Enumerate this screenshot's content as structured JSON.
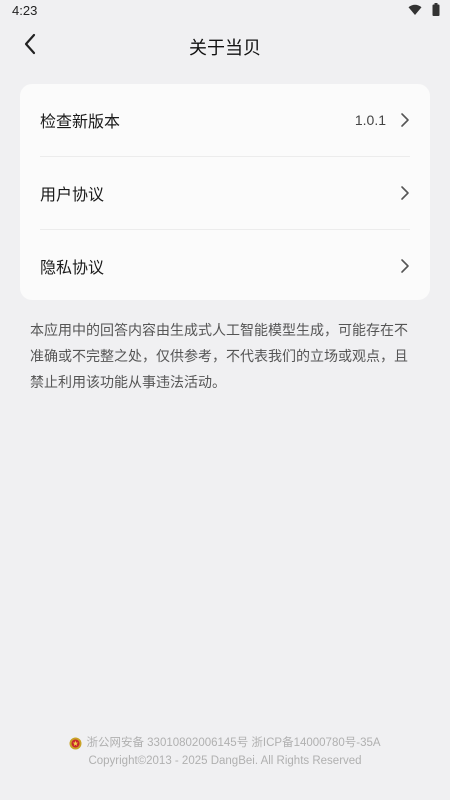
{
  "status_bar": {
    "time": "4:23",
    "wifi_icon": "wifi-icon",
    "battery_icon": "battery-icon"
  },
  "nav": {
    "back_icon": "chevron-left-icon",
    "title": "关于当贝"
  },
  "menu": {
    "items": [
      {
        "label": "检查新版本",
        "value": "1.0.1",
        "icon": "chevron-right-icon"
      },
      {
        "label": "用户协议",
        "value": "",
        "icon": "chevron-right-icon"
      },
      {
        "label": "隐私协议",
        "value": "",
        "icon": "chevron-right-icon"
      }
    ]
  },
  "disclaimer": "本应用中的回答内容由生成式人工智能模型生成，可能存在不准确或不完整之处，仅供参考，不代表我们的立场或观点，且禁止利用该功能从事违法活动。",
  "footer": {
    "emblem_icon": "police-emblem-icon",
    "record": "浙公网安备 33010802006145号 浙ICP备14000780号-35A",
    "copyright": "Copyright©2013 - 2025 DangBei. All Rights Reserved"
  },
  "colors": {
    "background": "#f0f0f2",
    "card": "#fbfbfb",
    "footer_text": "#b0b0b0"
  }
}
